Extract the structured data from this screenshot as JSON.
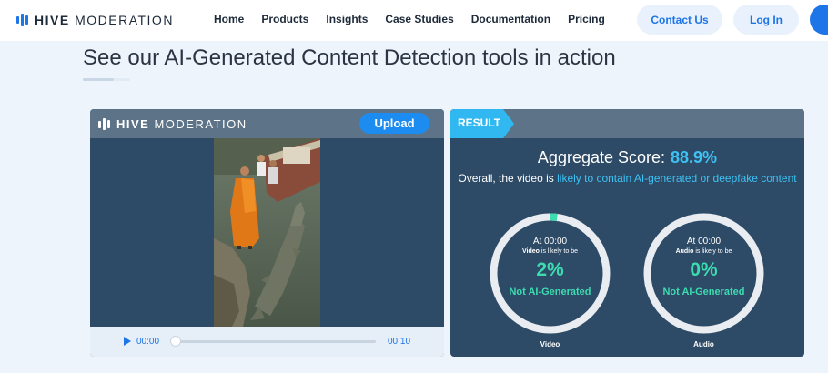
{
  "nav": {
    "logo_bold": "HIVE",
    "logo_rest": "MODERATION",
    "links": [
      "Home",
      "Products",
      "Insights",
      "Case Studies",
      "Documentation",
      "Pricing"
    ],
    "contact_label": "Contact Us",
    "login_label": "Log In"
  },
  "heading": "See our AI-Generated Content Detection tools in action",
  "left_panel": {
    "logo_bold": "HIVE",
    "logo_rest": "MODERATION",
    "upload_label": "Upload",
    "player": {
      "current_time": "00:00",
      "duration": "00:10",
      "progress": 0
    }
  },
  "result": {
    "tag": "RESULT",
    "aggregate_label": "Aggregate Score:",
    "aggregate_value": "88.9%",
    "overall_prefix": "Overall, the video is",
    "overall_highlight": "likely to contain AI-generated or deepfake content",
    "gauges": [
      {
        "at": "At 00:00",
        "subject": "Video",
        "likely": "is likely to be",
        "percent": "2%",
        "fraction": 0.02,
        "verdict": "Not AI-Generated",
        "caption": "Video"
      },
      {
        "at": "At 00:00",
        "subject": "Audio",
        "likely": "is likely to be",
        "percent": "0%",
        "fraction": 0,
        "verdict": "Not AI-Generated",
        "caption": "Audio"
      }
    ]
  },
  "colors": {
    "accent": "#1d75e8",
    "result_accent": "#3ec1f3",
    "gauge_fill": "#3ddbb0",
    "panel_bg": "#2d4a66"
  },
  "icons": {
    "logo": "hive-bars-icon",
    "play": "play-icon"
  }
}
